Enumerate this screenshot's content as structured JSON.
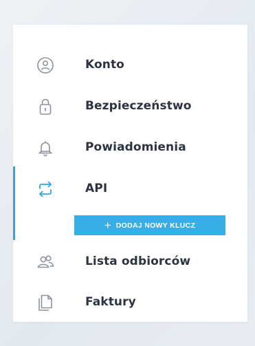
{
  "menu": {
    "items": [
      {
        "label": "Konto",
        "icon": "user-circle-icon",
        "active": false
      },
      {
        "label": "Bezpieczeństwo",
        "icon": "lock-icon",
        "active": false
      },
      {
        "label": "Powiadomienia",
        "icon": "bell-icon",
        "active": false
      },
      {
        "label": "API",
        "icon": "swap-arrows-icon",
        "active": true
      },
      {
        "label": "Lista odbiorców",
        "icon": "users-icon",
        "active": false
      },
      {
        "label": "Faktury",
        "icon": "documents-icon",
        "active": false
      }
    ],
    "add_key": {
      "plus": "+",
      "label": "DODAJ NOWY KLUCZ"
    }
  },
  "colors": {
    "accent": "#2ea7e0",
    "button": "#38aee6",
    "text": "#2b3440",
    "icon": "#8a939c",
    "panel": "#ffffff"
  }
}
